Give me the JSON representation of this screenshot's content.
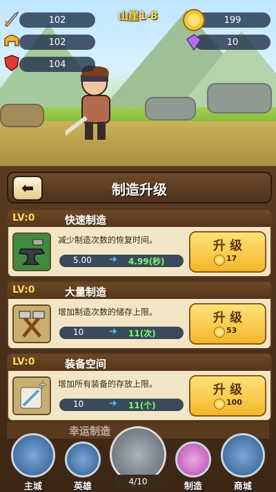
{
  "hud": {
    "stats": [
      {
        "name": "attack",
        "value": "102",
        "icon": "sword-icon"
      },
      {
        "name": "hero-power",
        "value": "102",
        "icon": "helmet-icon"
      },
      {
        "name": "defense",
        "value": "104",
        "icon": "shield-icon"
      }
    ],
    "level_title": "山崖1-8",
    "gold": "199",
    "gems": "10"
  },
  "panel": {
    "title": "制造升级",
    "back_icon": "arrow-left-icon"
  },
  "upgrades": [
    {
      "lv": "LV:0",
      "title": "快速制造",
      "desc": "减少制造次数的恢复时间。",
      "old": "5.00",
      "new": "4.99(秒)",
      "button": "升 级",
      "cost": "17",
      "icon": "anvil-icon"
    },
    {
      "lv": "LV:0",
      "title": "大量制造",
      "desc": "增加制造次数的储存上限。",
      "old": "10",
      "new": "11(次)",
      "button": "升 级",
      "cost": "53",
      "icon": "hammers-icon"
    },
    {
      "lv": "LV:0",
      "title": "装备空间",
      "desc": "增加所有装备的存放上限。",
      "old": "10",
      "new": "11(个)",
      "button": "升 级",
      "cost": "100",
      "icon": "scroll-plus-icon"
    }
  ],
  "partial_row": {
    "title": "幸运制造"
  },
  "nav": {
    "items": [
      {
        "label": "主城",
        "icon": "castle-icon"
      },
      {
        "label": "英雄",
        "icon": "hero-helmet-icon"
      },
      {
        "label": "",
        "icon": "anvil-icon"
      },
      {
        "label": "制造",
        "icon": "potion-icon"
      },
      {
        "label": "商城",
        "icon": "treasure-chest-icon"
      }
    ],
    "page_indicator": "4/10"
  },
  "colors": {
    "gold": "#ffd84a",
    "panel": "#5b3b22",
    "button": "#f2b72a",
    "new_value": "#7cff6a"
  }
}
